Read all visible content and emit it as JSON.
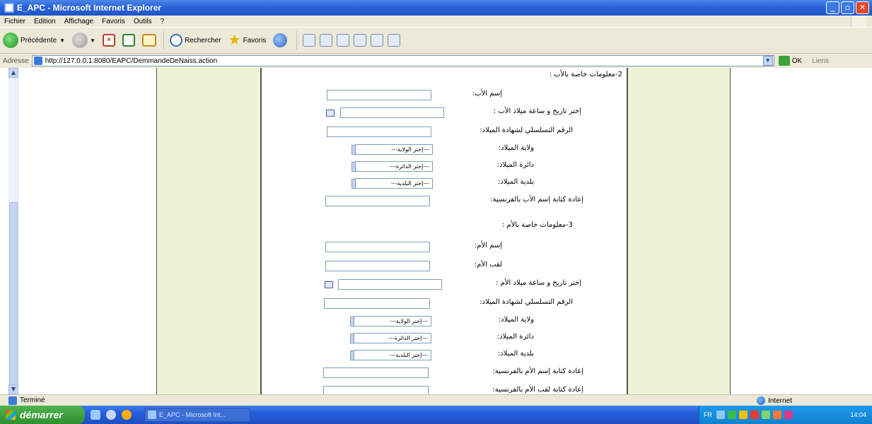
{
  "window": {
    "title": "E_APC - Microsoft Internet Explorer"
  },
  "menu": [
    "Fichier",
    "Edition",
    "Affichage",
    "Favoris",
    "Outils",
    "?"
  ],
  "toolbar": {
    "back": "Précédente",
    "search": "Rechercher",
    "favorites": "Favoris"
  },
  "address": {
    "label": "Adresse",
    "url": "http://127.0.0.1:8080/EAPC/DemmandeDeNaiss.action",
    "go": "OK",
    "links": "Liens"
  },
  "form": {
    "father_section": "2-معلومات خاصة بالأب :",
    "father_name": "إسم الأب:",
    "father_birth_datetime": "إختر تاريخ و ساعة ميلاد الأب :",
    "father_cert_serial": "الرقم التسلسلي لشهادة الميلاد:",
    "father_wilaya": "ولاية الميلاد:",
    "father_daira": "دائرة الميلاد:",
    "father_commune": "بلدية الميلاد:",
    "father_name_fr": "إعادة كتابة إسم الأب بالفرنسية:",
    "mother_section": "3-معلومات خاصة بالأم :",
    "mother_name": "إسم الأم:",
    "mother_surname": "لقب الأم:",
    "mother_birth_datetime": "إختر تاريخ و ساعة ميلاد الأم :",
    "mother_cert_serial": "الرقم التسلسلي لشهادة الميلاد:",
    "mother_wilaya": "ولاية الميلاد:",
    "mother_daira": "دائرة الميلاد:",
    "mother_commune": "بلدية الميلاد:",
    "mother_name_fr": "إعادة كتابة إسم الأم بالفرنسية:",
    "mother_surname_fr": "إعادة كتابة لقب الأم بالفرنسية:",
    "select_wilaya": "---إختر الولاية---",
    "select_daira": "---إختر الدائرة---",
    "select_commune": "---إختر البلدية---"
  },
  "status": {
    "text": "Terminé",
    "zone": "Internet"
  },
  "taskbar": {
    "start": "démarrer",
    "task": "E_APC - Microsoft Int...",
    "lang": "FR",
    "clock": "14:04"
  }
}
